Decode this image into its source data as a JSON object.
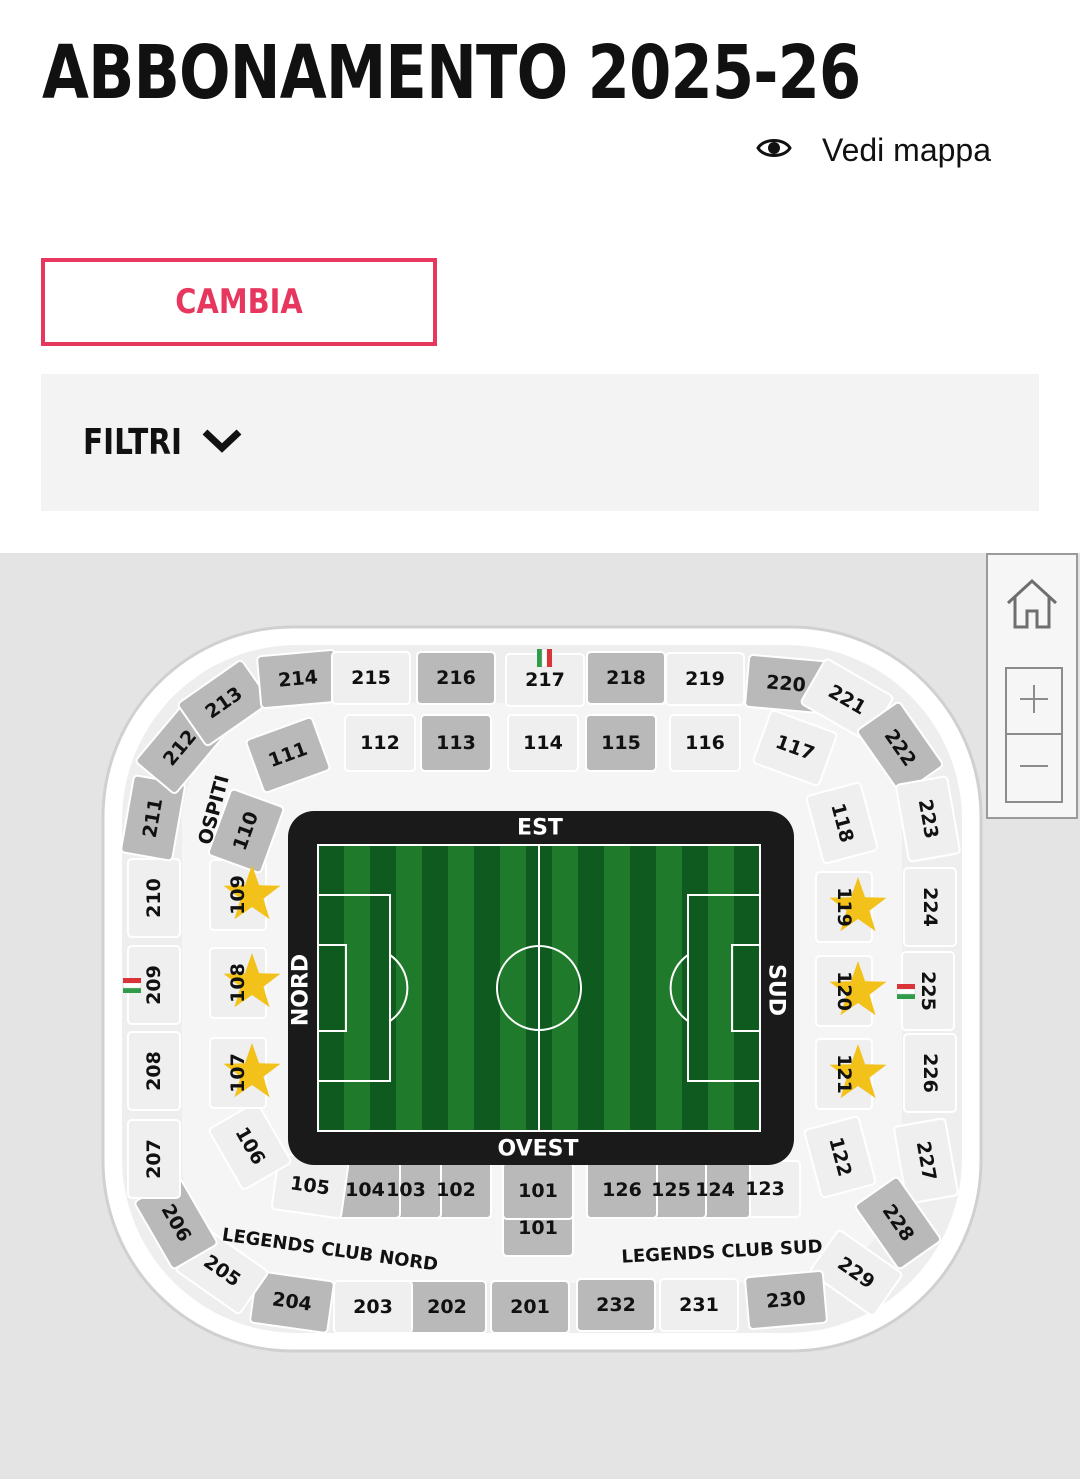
{
  "page": {
    "title": "ABBONAMENTO 2025-26"
  },
  "map_link": {
    "label": "Vedi mappa",
    "icon": "eye-icon"
  },
  "change_button": {
    "label": "CAMBIA"
  },
  "filters": {
    "label": "FILTRI",
    "icon": "chevron-down-icon"
  },
  "map_controls": {
    "home_icon": "home-icon",
    "zoom_in_icon": "plus-icon",
    "zoom_out_icon": "minus-icon"
  },
  "stadium": {
    "stand_labels": {
      "north": "NORD",
      "south": "SUD",
      "east": "EST",
      "west": "OVEST"
    },
    "guest_label": "OSPITI",
    "legends_north": "LEGENDS CLUB NORD",
    "legends_south": "LEGENDS CLUB SUD",
    "sections": [
      "101",
      "101",
      "102",
      "103",
      "104",
      "105",
      "106",
      "107",
      "108",
      "109",
      "110",
      "111",
      "112",
      "113",
      "114",
      "115",
      "116",
      "117",
      "118",
      "119",
      "120",
      "121",
      "122",
      "123",
      "124",
      "125",
      "126",
      "201",
      "202",
      "203",
      "204",
      "205",
      "206",
      "207",
      "208",
      "209",
      "210",
      "211",
      "212",
      "213",
      "214",
      "215",
      "216",
      "217",
      "218",
      "219",
      "220",
      "221",
      "222",
      "223",
      "224",
      "225",
      "226",
      "227",
      "228",
      "229",
      "230",
      "231",
      "232"
    ],
    "star_sections": [
      "107",
      "108",
      "109",
      "119",
      "120",
      "121"
    ],
    "flag_sections": [
      "209",
      "217",
      "225"
    ],
    "colors": {
      "accent": "#e8375f",
      "pitch_dark": "#0f5a1e",
      "pitch_light": "#1f7a2c",
      "pitch_border": "#1a1a1a",
      "section_fill": "#b9b9b9",
      "section_light": "#efefef",
      "star": "#f2c21a",
      "flag_green": "#2e9c48",
      "flag_red": "#d9343a"
    }
  }
}
